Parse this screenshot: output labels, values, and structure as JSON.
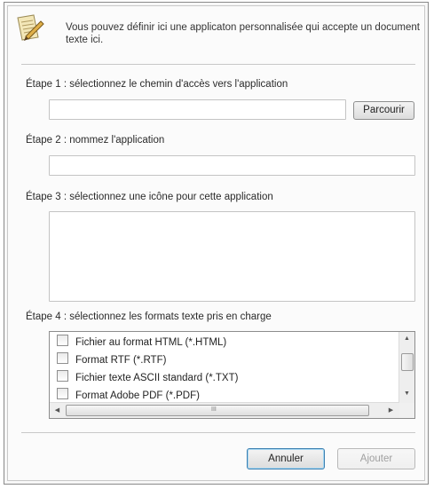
{
  "header": {
    "icon": "document-pen-icon",
    "text": "Vous pouvez définir ici une applicaton personnalisée qui accepte un document texte ici."
  },
  "step1": {
    "label": "Étape 1 : sélectionnez le chemin d'accès vers l'application",
    "path_value": "",
    "browse_label": "Parcourir"
  },
  "step2": {
    "label": "Étape 2 : nommez l'application",
    "name_value": ""
  },
  "step3": {
    "label": "Étape 3 : sélectionnez une icône pour cette application"
  },
  "step4": {
    "label": "Étape 4 : sélectionnez les formats texte pris en charge",
    "formats": [
      {
        "label": "Fichier au format HTML (*.HTML)",
        "checked": false
      },
      {
        "label": "Format RTF (*.RTF)",
        "checked": false
      },
      {
        "label": "Fichier texte ASCII standard (*.TXT)",
        "checked": false
      },
      {
        "label": "Format Adobe PDF (*.PDF)",
        "checked": false
      }
    ],
    "hscroll_grip": "III"
  },
  "buttons": {
    "cancel_label": "Annuler",
    "add_label": "Ajouter"
  },
  "colors": {
    "accent_border": "#3c7fb1",
    "disabled_text": "#a0a0a0"
  }
}
